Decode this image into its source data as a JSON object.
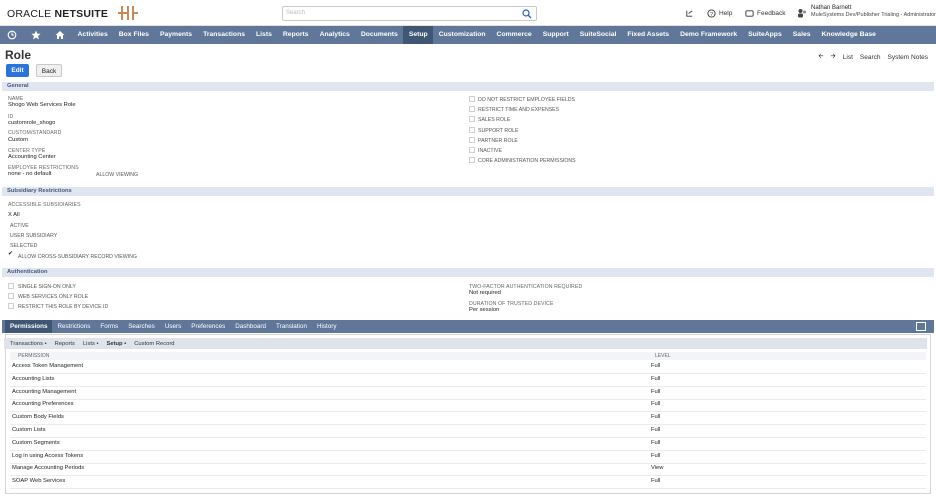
{
  "brand": {
    "oracle": "ORACLE",
    "netsuite": "NETSUITE"
  },
  "search": {
    "placeholder": "Search"
  },
  "top_links": {
    "help": "Help",
    "feedback": "Feedback"
  },
  "user": {
    "name": "Nathan Barnett",
    "role": "MuleSystems Dev/Publisher Trialing - Administrator"
  },
  "nav": [
    "Activities",
    "Box Files",
    "Payments",
    "Transactions",
    "Lists",
    "Reports",
    "Analytics",
    "Documents",
    "Setup",
    "Customization",
    "Commerce",
    "Support",
    "SuiteSocial",
    "Fixed Assets",
    "Demo Framework",
    "SuiteApps",
    "Sales",
    "Knowledge Base"
  ],
  "page": {
    "title": "Role",
    "list": "List",
    "search": "Search",
    "system_notes": "System Notes",
    "edit": "Edit",
    "back": "Back"
  },
  "general": {
    "header": "General",
    "name_label": "Name",
    "name_value": "Shogo Web Services Role",
    "id_label": "ID",
    "id_value": "customrole_shogo",
    "custom_label": "Custom/Standard",
    "custom_value": "Custom",
    "center_label": "Center Type",
    "center_value": "Accounting Center",
    "emp_label": "Employee Restrictions",
    "emp_value": "none - no default",
    "allow_viewing": "Allow Viewing",
    "right_checks": [
      "Do Not Restrict Employee Fields",
      "Restrict Time and Expenses",
      "Sales Role",
      "Support Role",
      "Partner Role",
      "Inactive",
      "Core Administration Permissions"
    ]
  },
  "subsidiary": {
    "header": "Subsidiary Restrictions",
    "accessible_label": "Accessible Subsidiaries",
    "options": [
      "All",
      "Active",
      "User Subsidiary",
      "Selected"
    ],
    "cross_label": "Allow Cross-Subsidiary Record Viewing"
  },
  "auth": {
    "header": "Authentication",
    "checks": [
      "Single Sign-On Only",
      "Web Services Only Role",
      "Restrict This Role By Device ID"
    ],
    "twofa_label": "Two-Factor Authentication Required",
    "twofa_value": "Not required",
    "duration_label": "Duration of Trusted Device",
    "duration_value": "Per session"
  },
  "tabs": [
    "Permissions",
    "Restrictions",
    "Forms",
    "Searches",
    "Users",
    "Preferences",
    "Dashboard",
    "Translation",
    "History"
  ],
  "subtabs": [
    "Transactions •",
    "Reports",
    "Lists •",
    "Setup •",
    "Custom Record"
  ],
  "table": {
    "col_permission": "Permission",
    "col_level": "Level",
    "rows": [
      {
        "permission": "Access Token Management",
        "level": "Full"
      },
      {
        "permission": "Accounting Lists",
        "level": "Full"
      },
      {
        "permission": "Accounting Management",
        "level": "Full"
      },
      {
        "permission": "Accounting Preferences",
        "level": "Full"
      },
      {
        "permission": "Custom Body Fields",
        "level": "Full"
      },
      {
        "permission": "Custom Lists",
        "level": "Full"
      },
      {
        "permission": "Custom Segments",
        "level": "Full"
      },
      {
        "permission": "Log in using Access Tokens",
        "level": "Full"
      },
      {
        "permission": "Manage Accounting Periods",
        "level": "View"
      },
      {
        "permission": "SOAP Web Services",
        "level": "Full"
      }
    ]
  },
  "colors": {
    "nav_bg": "#607799",
    "nav_active": "#3f5674",
    "edit_btn": "#2b73d8",
    "section_bg": "#e0e6ef"
  }
}
